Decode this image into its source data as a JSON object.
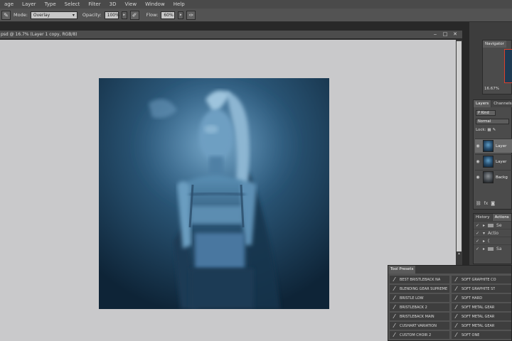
{
  "menu": [
    "age",
    "Layer",
    "Type",
    "Select",
    "Filter",
    "3D",
    "View",
    "Window",
    "Help"
  ],
  "options": {
    "mode_label": "Mode:",
    "mode_value": "Overlay",
    "opacity_label": "Opacity:",
    "opacity_value": "100%",
    "flow_label": "Flow:",
    "flow_value": "60%"
  },
  "document": {
    "title": "psd @ 16.7% (Layer 1 copy, RGB/8)",
    "controls": [
      "‒",
      "□",
      "✕"
    ]
  },
  "navigator": {
    "tab": "Navigator",
    "zoom": "16.67%"
  },
  "layers": {
    "tabs": [
      "Layers",
      "Channels"
    ],
    "filter_kind": "P Kind",
    "blend_mode": "Normal",
    "lock_label": "Lock:",
    "items": [
      {
        "name": "Layer",
        "selected": true
      },
      {
        "name": "Layer",
        "selected": false
      },
      {
        "name": "Backg",
        "selected": false
      }
    ],
    "footer_icons": [
      "⛓",
      "fx",
      "◙"
    ]
  },
  "history": {
    "tabs": [
      "History",
      "Actions"
    ],
    "rows": [
      {
        "label": "Se"
      },
      {
        "label": "Actio"
      },
      {
        "label": "("
      },
      {
        "label": "Sa"
      }
    ]
  },
  "tool_presets": {
    "tab": "Tool Presets",
    "items": [
      "BEST BRISTLEBACK NA",
      "SOFT GRAPHITE CO",
      "BLENDING GEAR SUPREME",
      "SOFT GRAPHITE ST",
      "BRISTLE LOW",
      "SOFT HARD",
      "BRISTLEBACK 2",
      "SOFT METAL GEAR",
      "BRISTLEBACK MAIN",
      "SOFT METAL GEAR",
      "CUSHART VARIATION",
      "SOFT METAL GEAR",
      "CUSTOM CHOIR 2",
      "SOFT ONE"
    ]
  },
  "colors": {
    "canvas_bg": "#c9c9cb",
    "panel_bg": "#4b4b4b",
    "art_dark": "#0f2538",
    "art_mid": "#3f7199",
    "art_light": "#a9cde4"
  }
}
